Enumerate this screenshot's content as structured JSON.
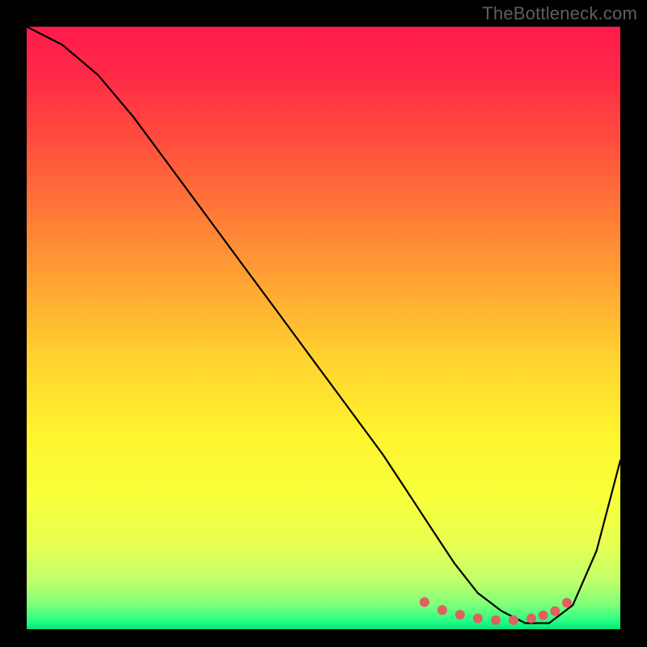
{
  "watermark": "TheBottleneck.com",
  "gradient": {
    "stops": [
      {
        "offset": 0.0,
        "color": "#ff1a4b"
      },
      {
        "offset": 0.08,
        "color": "#ff2a47"
      },
      {
        "offset": 0.18,
        "color": "#ff4a3e"
      },
      {
        "offset": 0.3,
        "color": "#ff7638"
      },
      {
        "offset": 0.42,
        "color": "#ffa233"
      },
      {
        "offset": 0.55,
        "color": "#ffd22f"
      },
      {
        "offset": 0.68,
        "color": "#fff42f"
      },
      {
        "offset": 0.78,
        "color": "#f8ff3a"
      },
      {
        "offset": 0.86,
        "color": "#e6ff52"
      },
      {
        "offset": 0.92,
        "color": "#c0ff6a"
      },
      {
        "offset": 0.96,
        "color": "#7dff7a"
      },
      {
        "offset": 0.985,
        "color": "#2bff83"
      },
      {
        "offset": 1.0,
        "color": "#00e77a"
      }
    ]
  },
  "chart_data": {
    "type": "line",
    "title": "",
    "xlabel": "",
    "ylabel": "",
    "xlim": [
      0,
      100
    ],
    "ylim": [
      0,
      100
    ],
    "series": [
      {
        "name": "curve",
        "x": [
          0,
          6,
          12,
          18,
          24,
          30,
          36,
          42,
          48,
          54,
          60,
          64,
          68,
          72,
          76,
          80,
          84,
          88,
          92,
          96,
          100
        ],
        "values": [
          100,
          97,
          92,
          85,
          77,
          69,
          61,
          53,
          45,
          37,
          29,
          23,
          17,
          11,
          6,
          3,
          1,
          1,
          4,
          13,
          28
        ]
      }
    ],
    "markers": {
      "name": "bottom-dots",
      "x": [
        67,
        70,
        73,
        76,
        79,
        82,
        85,
        87,
        89,
        91
      ],
      "values": [
        4.5,
        3.2,
        2.4,
        1.8,
        1.5,
        1.5,
        1.8,
        2.3,
        3.0,
        4.4
      ],
      "color": "#e06060",
      "radius": 6
    }
  }
}
